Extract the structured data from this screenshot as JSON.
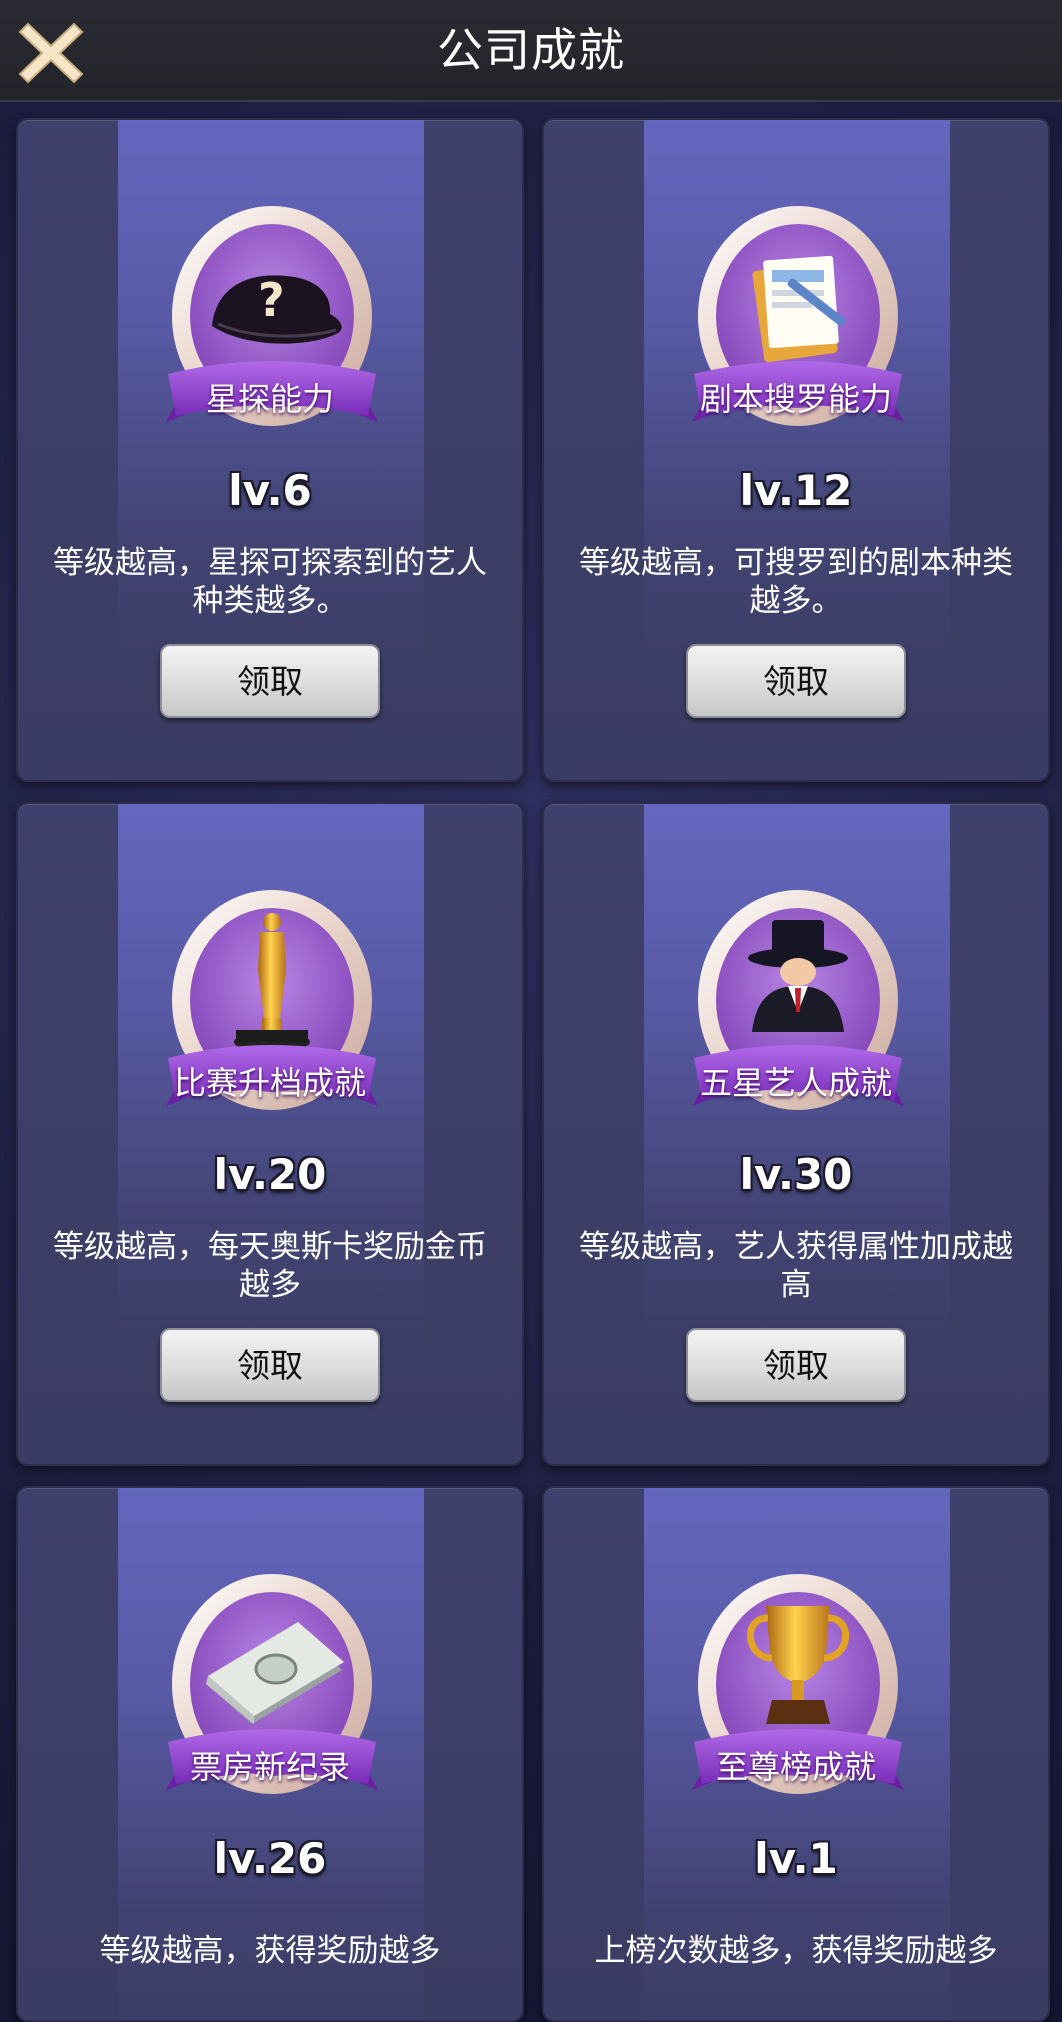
{
  "header": {
    "title": "公司成就",
    "close_icon": "close-x-icon"
  },
  "colors": {
    "badge_purple": "#8a3bc7",
    "medal_inner": "#9b5bd0",
    "claim_button": "#dedede",
    "card_bg": "#3f416d",
    "beam": "#6467be"
  },
  "achievements": [
    {
      "label": "星探能力",
      "level": "lv.6",
      "desc": "等级越高，星探可探索到的艺人种类越多。",
      "button": "领取",
      "icon": "detective-hat-icon"
    },
    {
      "label": "剧本搜罗能力",
      "level": "lv.12",
      "desc": "等级越高，可搜罗到的剧本种类越多。",
      "button": "领取",
      "icon": "script-papers-icon"
    },
    {
      "label": "比赛升档成就",
      "level": "lv.20",
      "desc": "等级越高，每天奥斯卡奖励金币越多",
      "button": "领取",
      "icon": "oscar-statuette-icon"
    },
    {
      "label": "五星艺人成就",
      "level": "lv.30",
      "desc": "等级越高，艺人获得属性加成越高",
      "button": "领取",
      "icon": "top-hat-agent-icon"
    },
    {
      "label": "票房新纪录",
      "level": "lv.26",
      "desc": "等级越高，获得奖励越多",
      "icon": "money-stack-icon"
    },
    {
      "label": "至尊榜成就",
      "level": "lv.1",
      "desc": "上榜次数越多，获得奖励越多",
      "icon": "gold-trophy-icon"
    }
  ]
}
